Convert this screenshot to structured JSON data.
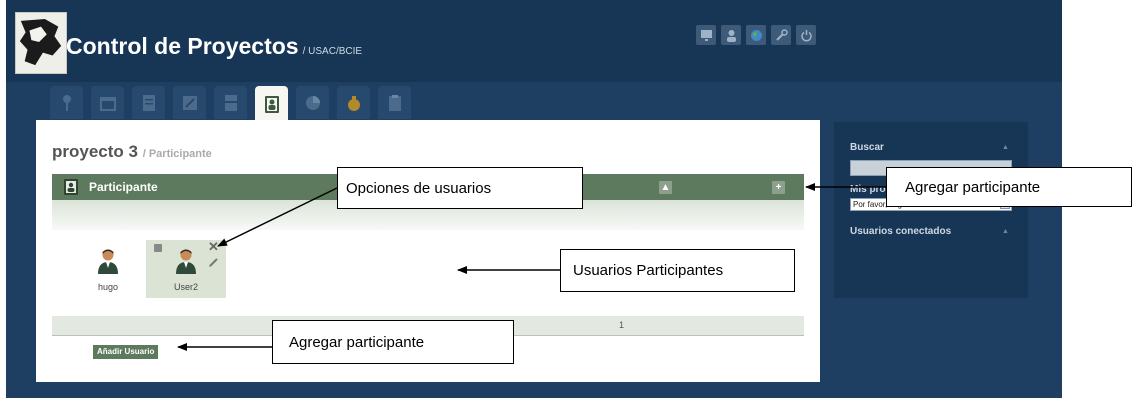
{
  "app": {
    "title": "Control de Proyectos",
    "subtitle": "/ USAC/BCIE"
  },
  "top_icons": [
    "monitor-icon",
    "user-icon",
    "globe-icon",
    "wrench-icon",
    "power-icon"
  ],
  "tabs": [
    {
      "icon": "pin-icon"
    },
    {
      "icon": "calendar-icon"
    },
    {
      "icon": "list-icon"
    },
    {
      "icon": "edit-icon"
    },
    {
      "icon": "server-icon"
    },
    {
      "icon": "participant-icon",
      "active": true
    },
    {
      "icon": "chart-icon"
    },
    {
      "icon": "money-bag-icon"
    },
    {
      "icon": "clipboard-icon"
    }
  ],
  "project": {
    "name": "proyecto 3",
    "section": "/ Participante"
  },
  "participants_panel": {
    "title": "Participante",
    "collapse_symbol": "▲",
    "add_symbol": "+",
    "users": [
      {
        "name": "hugo"
      },
      {
        "name": "User2",
        "delete_symbol": "✕"
      }
    ],
    "page": "1",
    "add_button": "Añadir Usuario"
  },
  "sidebar": {
    "search_label": "Buscar",
    "search_value": "",
    "projects_label": "Mis proyectos",
    "project_select": "Por favor, elige",
    "connected_label": "Usuarios conectados",
    "caret": "▲"
  },
  "annotations": {
    "user_options": "Opciones de usuarios",
    "add_participant_top": "Agregar participante",
    "participant_users": "Usuarios Participantes",
    "add_participant_bottom": "Agregar participante"
  },
  "colors": {
    "app_background": "#1e3f62",
    "topbar": "#173555",
    "section_header": "#5d7a5e",
    "user_card_highlight": "#dbe4d4"
  }
}
